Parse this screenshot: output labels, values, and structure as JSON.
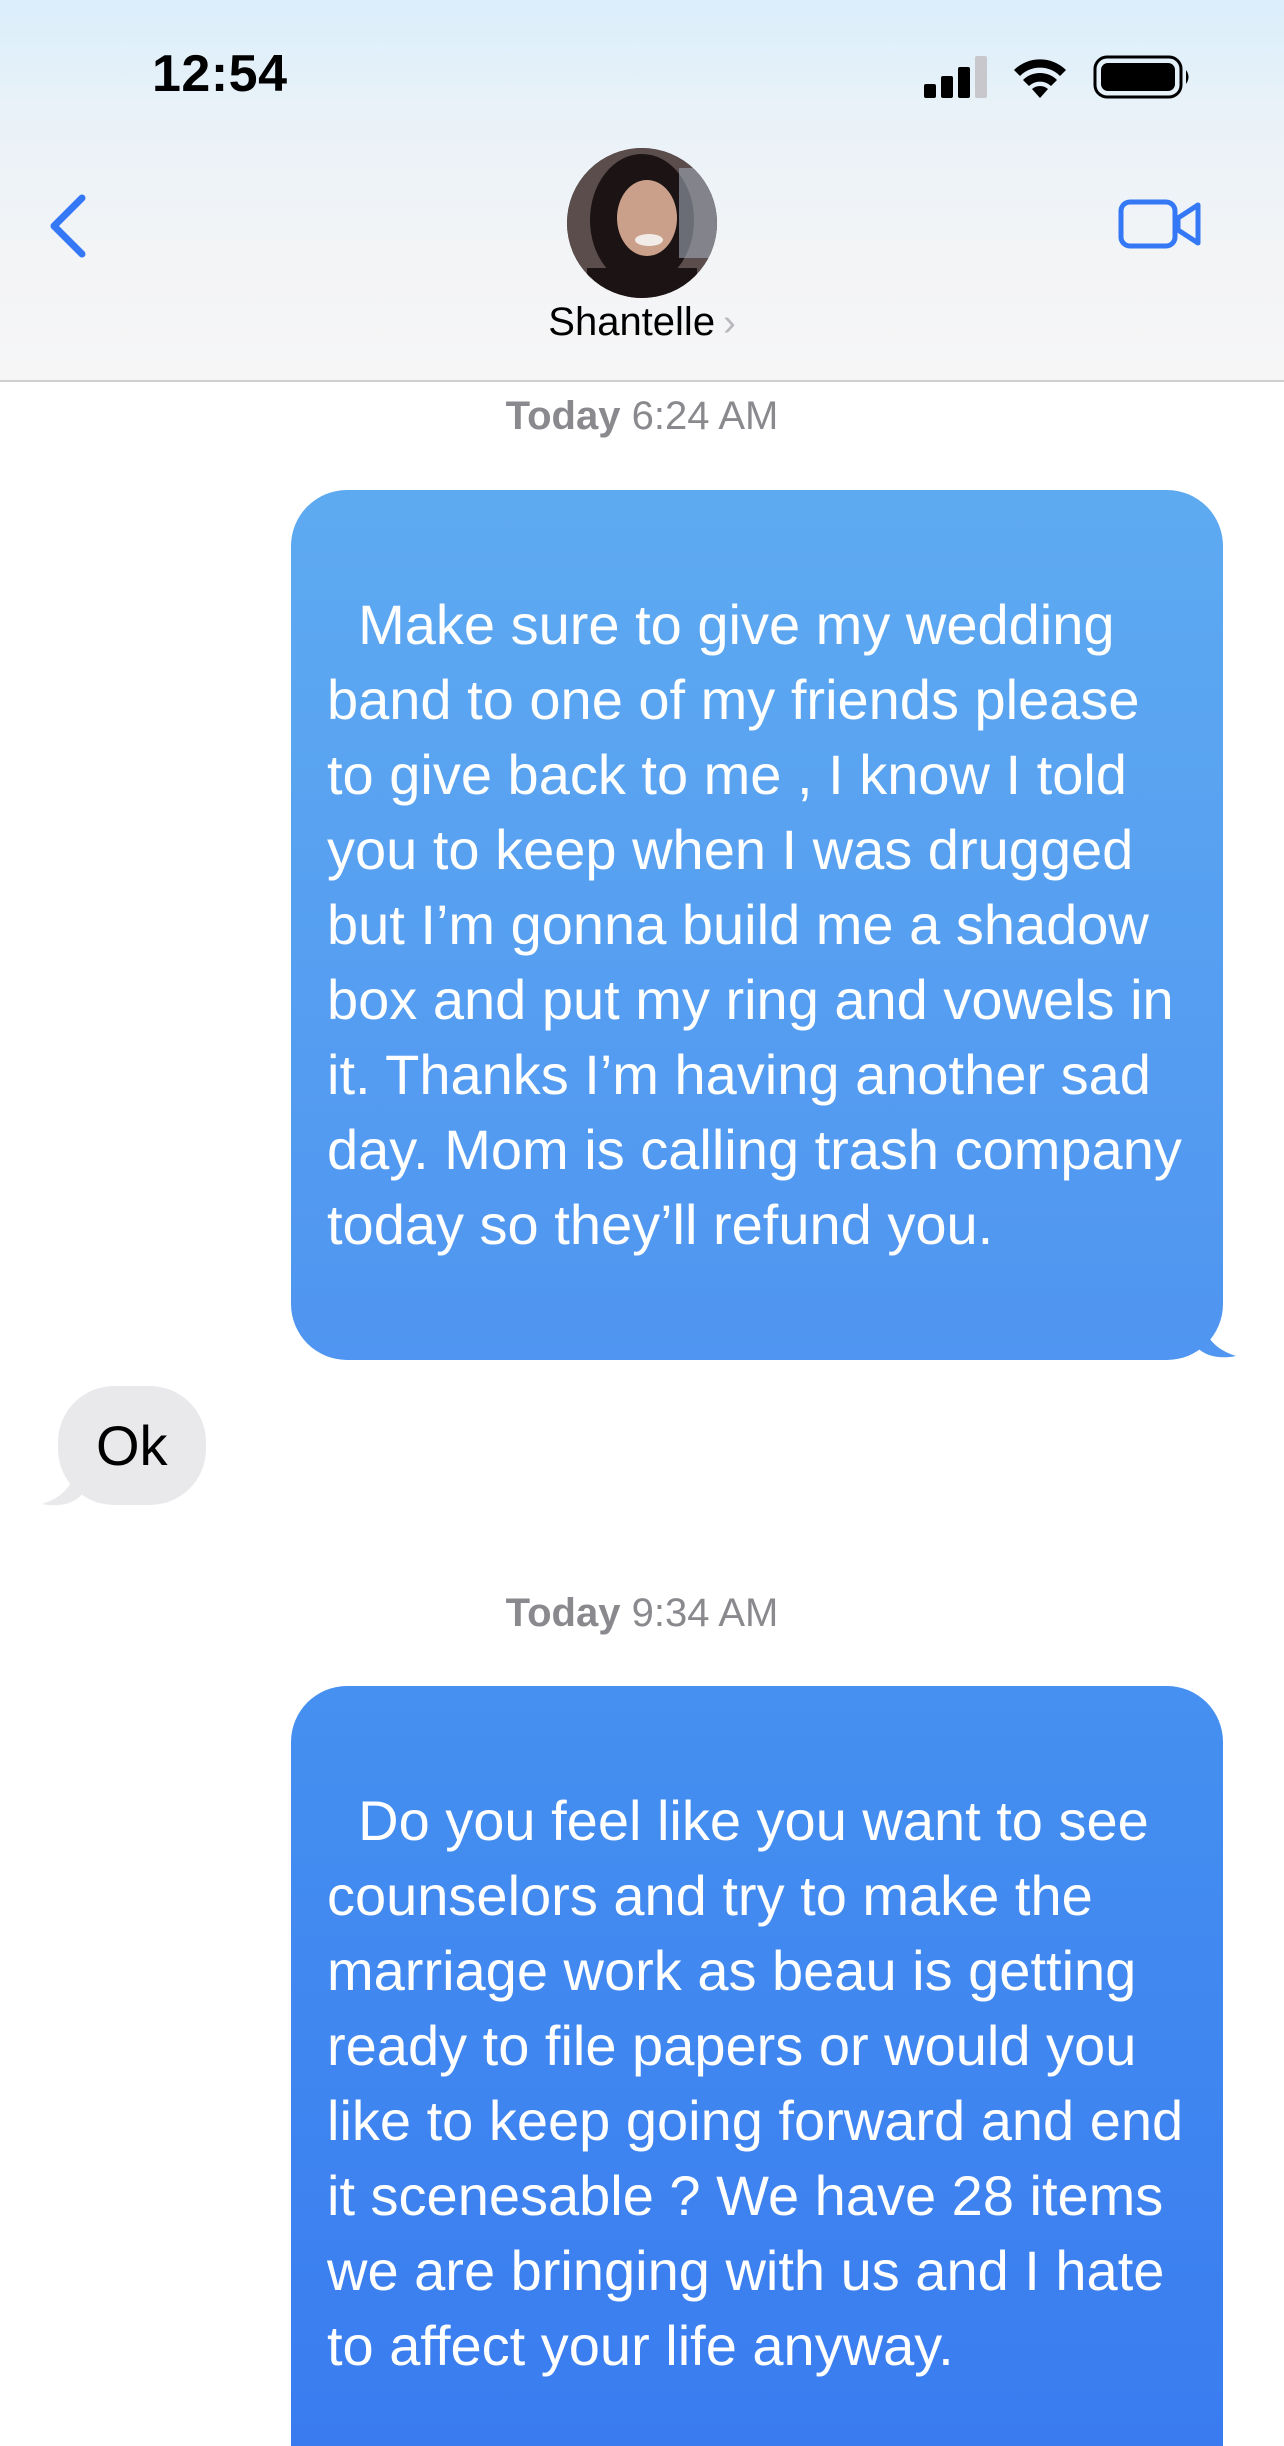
{
  "status_bar": {
    "time": "12:54"
  },
  "header": {
    "contact_name": "Shantelle",
    "chevron": "›"
  },
  "messages": [
    {
      "timestamp_day": "Today",
      "timestamp_time": "6:24 AM"
    },
    {
      "direction": "outgoing",
      "text": "Make sure to give my wedding band to one of my friends please to give back to me , I know I told you to keep when I was drugged but I’m gonna build me a shadow box and put my ring and vowels in it. Thanks I’m having another sad day. Mom is calling trash company today so they’ll refund you."
    },
    {
      "direction": "incoming",
      "text": "Ok"
    },
    {
      "timestamp_day": "Today",
      "timestamp_time": "9:34 AM"
    },
    {
      "direction": "outgoing",
      "text": "Do you feel like you want to see counselors and try to make the marriage work as beau is getting ready to file papers or would you like to keep going forward and end it scenesable ? We have 28 items we are bringing with us and I hate to affect your life anyway."
    }
  ],
  "colors": {
    "outgoing_bubble_top": "#5eaaf1",
    "outgoing_bubble_bottom": "#3a7cf0",
    "incoming_bubble": "#e9e9eb",
    "accent": "#3478f6"
  }
}
